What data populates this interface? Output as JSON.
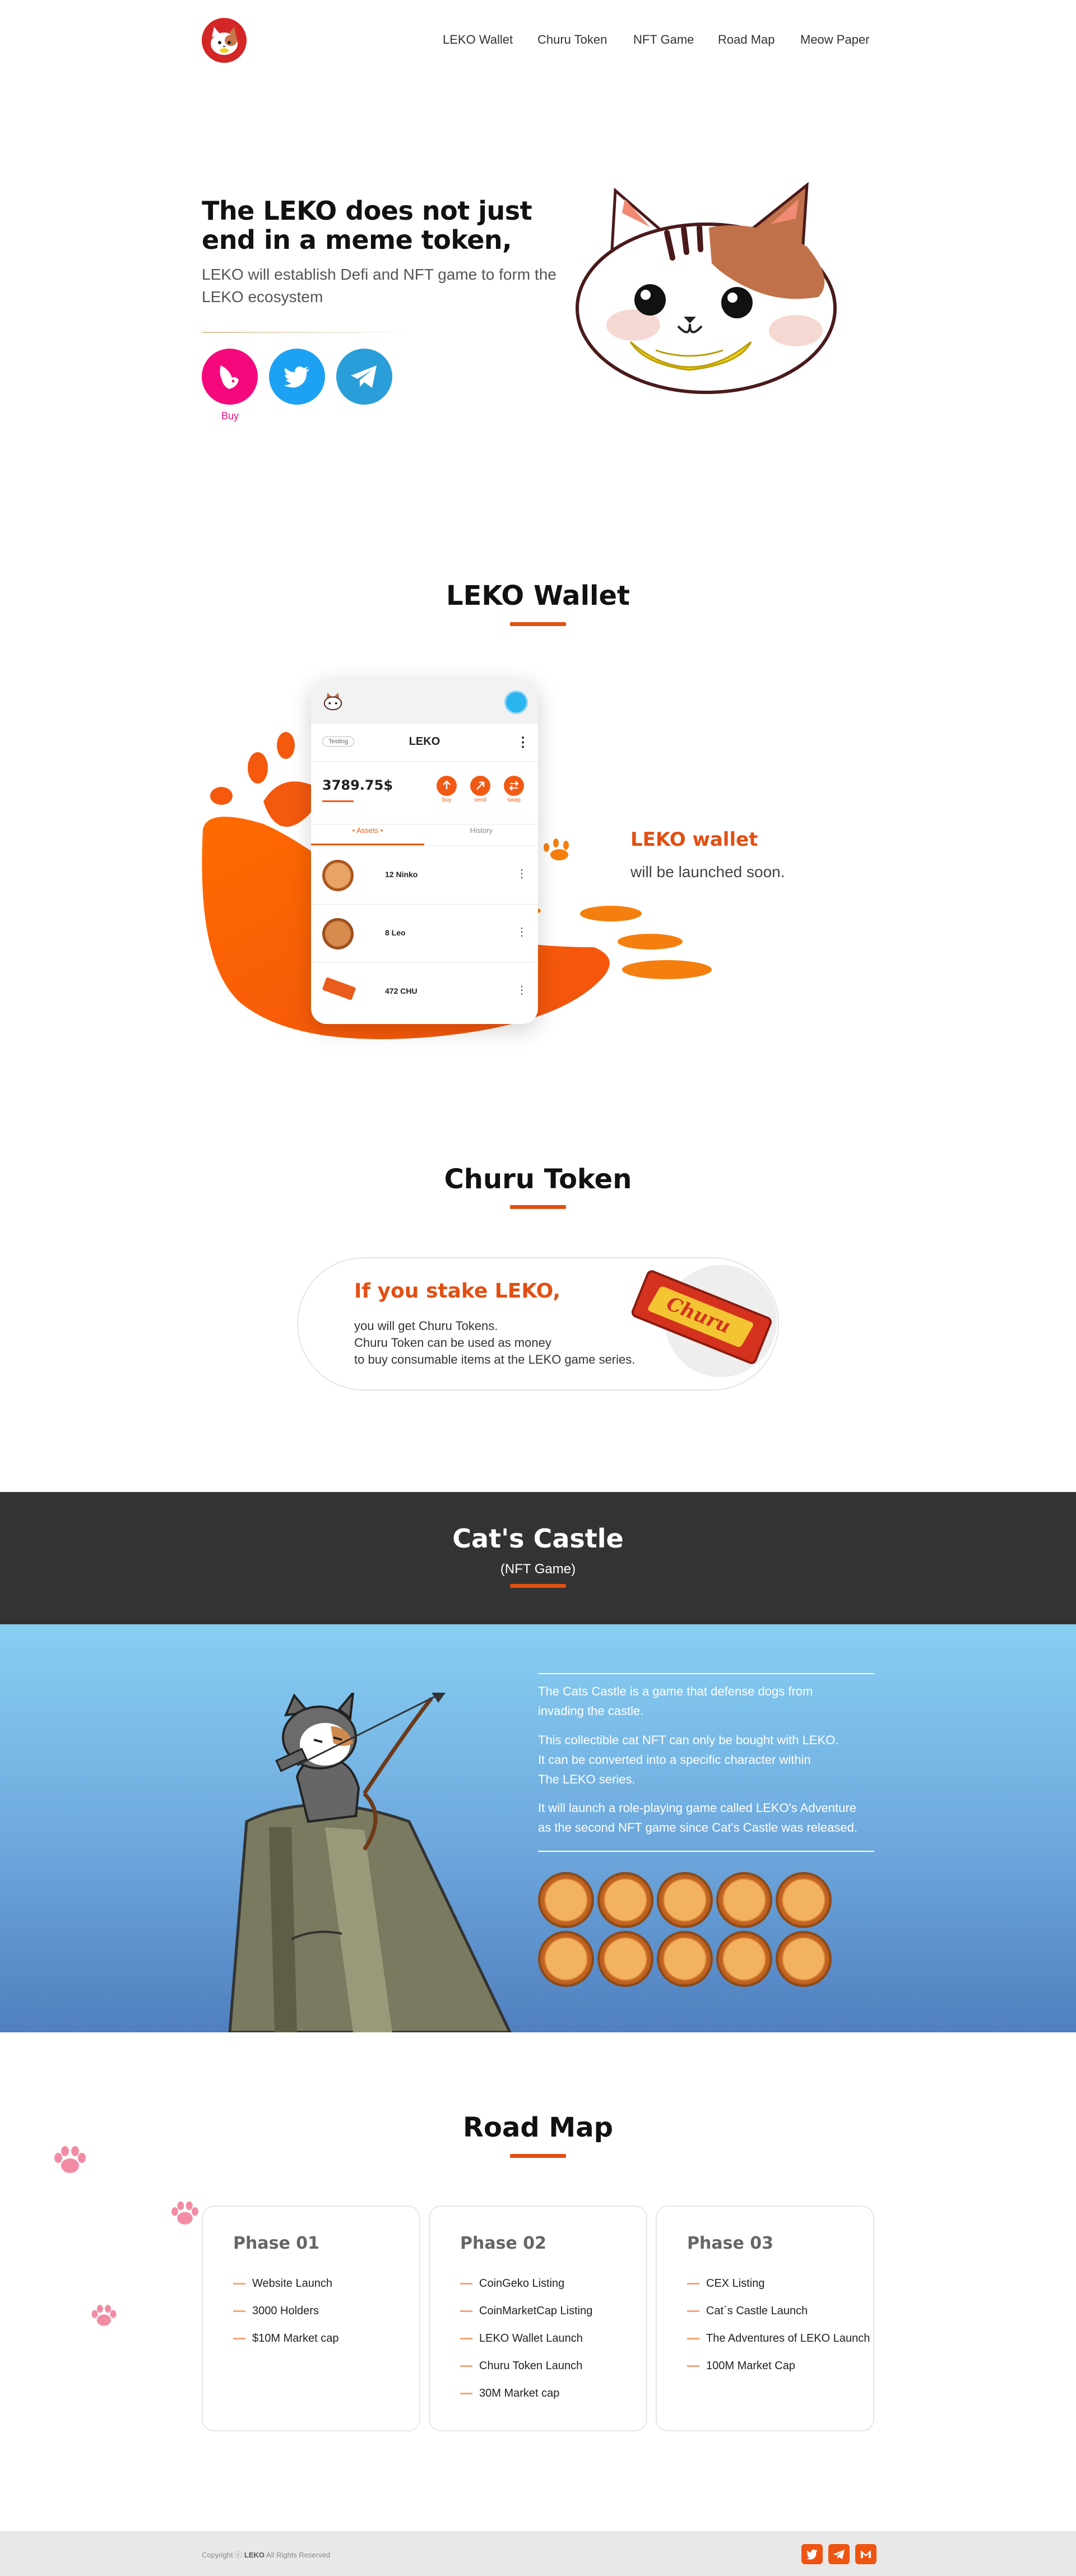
{
  "nav": {
    "logo": "leko-cat-logo",
    "links": [
      "LEKO Wallet",
      "Churu Token",
      "NFT Game",
      "Road Map",
      "Meow Paper"
    ]
  },
  "hero": {
    "title": "The LEKO does not just end in a meme token,",
    "subtitle": "LEKO will establish Defi and NFT game to form the LEKO ecosystem",
    "buy_label": "Buy",
    "social_icons": [
      "uniswap-icon",
      "twitter-icon",
      "telegram-icon"
    ]
  },
  "wallet": {
    "section_title": "LEKO Wallet",
    "phone": {
      "network_badge": "Testing",
      "title": "LEKO",
      "balance": "3789.75$",
      "actions": [
        "buy",
        "send",
        "swap"
      ],
      "tabs": [
        "Assets",
        "History"
      ],
      "tokens": [
        "12 Ninko",
        "8 Leo",
        "472 CHU"
      ]
    },
    "heading": "LEKO wallet",
    "text": "will be launched soon."
  },
  "churu": {
    "section_title": "Churu Token",
    "heading": "If you stake LEKO,",
    "lines": [
      "you will get Churu Tokens.",
      "Churu Token can be used as money",
      "to buy consumable items at the LEKO game series."
    ],
    "product_label": "Churu"
  },
  "castle": {
    "title": "Cat's Castle",
    "subtitle": "(NFT Game)",
    "paragraphs": [
      [
        "The Cats Castle is a game that defense dogs from",
        "invading the castle."
      ],
      [
        "This collectible cat NFT can only be bought with LEKO.",
        "It can be converted into a specific character within",
        "The LEKO series."
      ],
      [
        "It will launch a role-playing game called LEKO's Adventure",
        "as the second NFT game since Cat's Castle was released."
      ]
    ],
    "nft_count": 10
  },
  "roadmap": {
    "section_title": "Road Map",
    "phases": [
      {
        "title": "Phase 01",
        "items": [
          "Website Launch",
          "3000 Holders",
          "$10M Market cap"
        ]
      },
      {
        "title": "Phase 02",
        "items": [
          "CoinGeko Listing",
          "CoinMarketCap Listing",
          "LEKO Wallet Launch",
          "Churu Token Launch",
          "30M Market cap"
        ]
      },
      {
        "title": "Phase 03",
        "items": [
          "CEX Listing",
          "Cat`s Castle Launch",
          "The Adventures of LEKO Launch",
          "100M Market Cap"
        ]
      }
    ]
  },
  "footer": {
    "copyright_prefix": "Copyright ⓒ",
    "brand": "LEKO",
    "copyright_suffix": "All Rights Reserved",
    "icons": [
      "twitter-icon",
      "telegram-icon",
      "mail-icon"
    ]
  },
  "colors": {
    "accent": "#e24f12",
    "uniswap": "#f5087c",
    "twitter": "#1da1f2",
    "telegram": "#2a9ed8",
    "castle_bar": "#333333"
  }
}
